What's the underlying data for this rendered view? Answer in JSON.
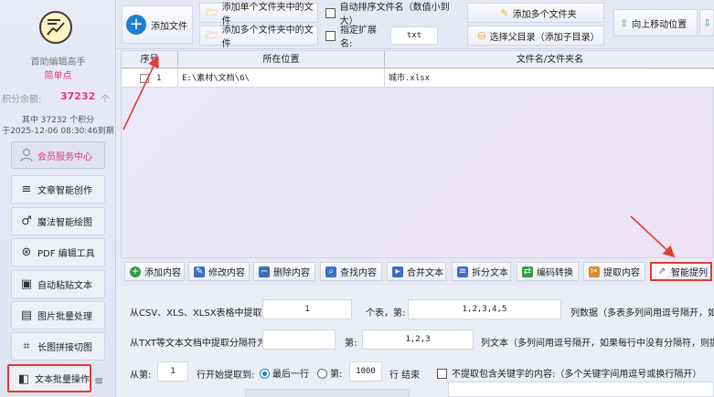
{
  "sidebar": {
    "app_name": "首助编辑高手",
    "edition": "简单点",
    "credit_label": "积分余额:",
    "credit_value": "37232",
    "credit_unit": "个",
    "credit_note_line1": "其中 37232 个积分",
    "credit_note_line2": "于2025-12-06 08:30:46到期",
    "member_button": "会员服务中心",
    "items": [
      {
        "label": "文章智能创作",
        "icon": "text-lines-icon"
      },
      {
        "label": "魔法智能绘图",
        "icon": "magic-wand-icon"
      },
      {
        "label": "PDF 编辑工具",
        "icon": "pdf-icon"
      },
      {
        "label": "自动粘贴文本",
        "icon": "paste-icon"
      },
      {
        "label": "图片批量处理",
        "icon": "image-icon"
      },
      {
        "label": "长图拼接切图",
        "icon": "crop-icon"
      },
      {
        "label": "文本批量操作",
        "icon": "text-batch-icon"
      }
    ]
  },
  "toolbar": {
    "add_file": "添加文件",
    "add_single_folder": "添加单个文件夹中的文件",
    "add_multi_folder": "添加多个文件夹中的文件",
    "auto_sort": "自动排序文件名（数值小到大）",
    "specify_ext": "指定扩展名:",
    "ext_value": "txt",
    "add_multi_folders": "添加多个文件夹",
    "select_parent": "选择父目录（添加子目录）",
    "move_up": "向上移动位置"
  },
  "table": {
    "columns": [
      "序号",
      "所在位置",
      "文件名/文件夹名"
    ],
    "rows": [
      {
        "index": "1",
        "location": "E:\\素材\\文档\\6\\",
        "name": "城市.xlsx"
      }
    ]
  },
  "actions": [
    {
      "label": "添加内容",
      "color": "#2e9e44",
      "glyph": "+"
    },
    {
      "label": "修改内容",
      "color": "#3a6fc2",
      "glyph": "✎"
    },
    {
      "label": "删除内容",
      "color": "#3a6fc2",
      "glyph": "−"
    },
    {
      "label": "查找内容",
      "color": "#3a6fc2",
      "glyph": "⌕"
    },
    {
      "label": "合并文本",
      "color": "#3a6fc2",
      "glyph": "▸"
    },
    {
      "label": "拆分文本",
      "color": "#3a6fc2",
      "glyph": "≡"
    },
    {
      "label": "编码转换",
      "color": "#2e9e44",
      "glyph": "⇄"
    },
    {
      "label": "提取内容",
      "color": "#e08a2e",
      "glyph": "✂"
    },
    {
      "label": "智能提列",
      "color": "#555555",
      "glyph": "⇗"
    }
  ],
  "settings": {
    "row1_label": "从CSV、XLS、XLSX表格中提取第:",
    "row1_table_value": "1",
    "row1_mid": "个表，第:",
    "row1_cols_value": "1,2,3,4,5",
    "row1_tail": "列数据（多表多列间用逗号隔开，如:",
    "row2_label": "从TXT等文本文档中提取分隔符为:",
    "row2_sep_value": "",
    "row2_mid": "第:",
    "row2_cols_value": "1,2,3",
    "row2_tail": "列文本（多列间用逗号隔开，如果每行中没有分隔符，则提取所",
    "row3_from": "从第:",
    "row3_start_value": "1",
    "row3_mid": "行开始提取到:",
    "row3_last_row": "最后一行",
    "row3_nth": "第:",
    "row3_end_value": "1000",
    "row3_end": "行 结束",
    "row3_exclude": "不提取包含关键字的内容:（多个关键字间用逗号或换行隔开）"
  },
  "colors": {
    "accent": "#1e7ed1",
    "highlight": "#e53935",
    "pink": "#e63c78"
  }
}
